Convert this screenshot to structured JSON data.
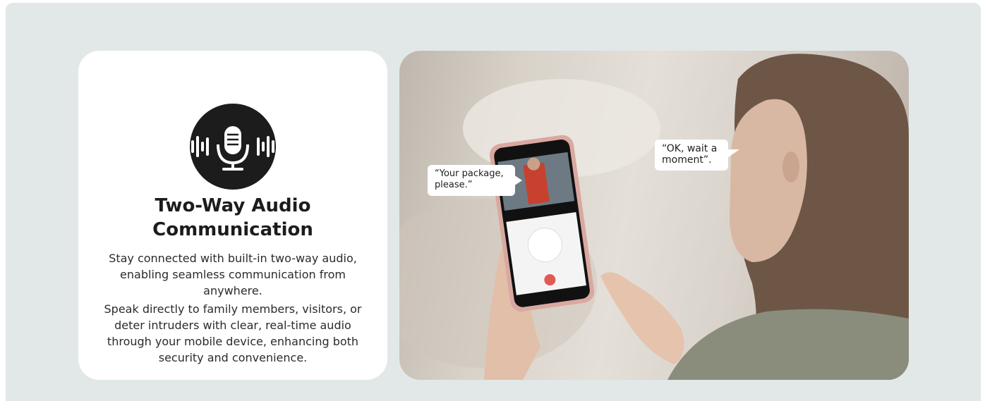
{
  "card": {
    "icon": "microphone-sound-waves-icon",
    "title_line1": "Two-Way Audio",
    "title_line2": "Communication",
    "desc_1": "Stay connected with built-in two-way audio, enabling seamless communication from anywhere.",
    "desc_2": "Speak directly to family members, visitors, or deter intruders with clear, real-time audio through your mobile device, enhancing both security and convenience."
  },
  "photo": {
    "bubble_visitor": "“Your package, please.”",
    "bubble_user": "“OK, wait a moment”."
  },
  "colors": {
    "background": "#e2e8e8",
    "card": "#ffffff",
    "badge": "#1c1c1c",
    "call_button": "#e05a52"
  }
}
